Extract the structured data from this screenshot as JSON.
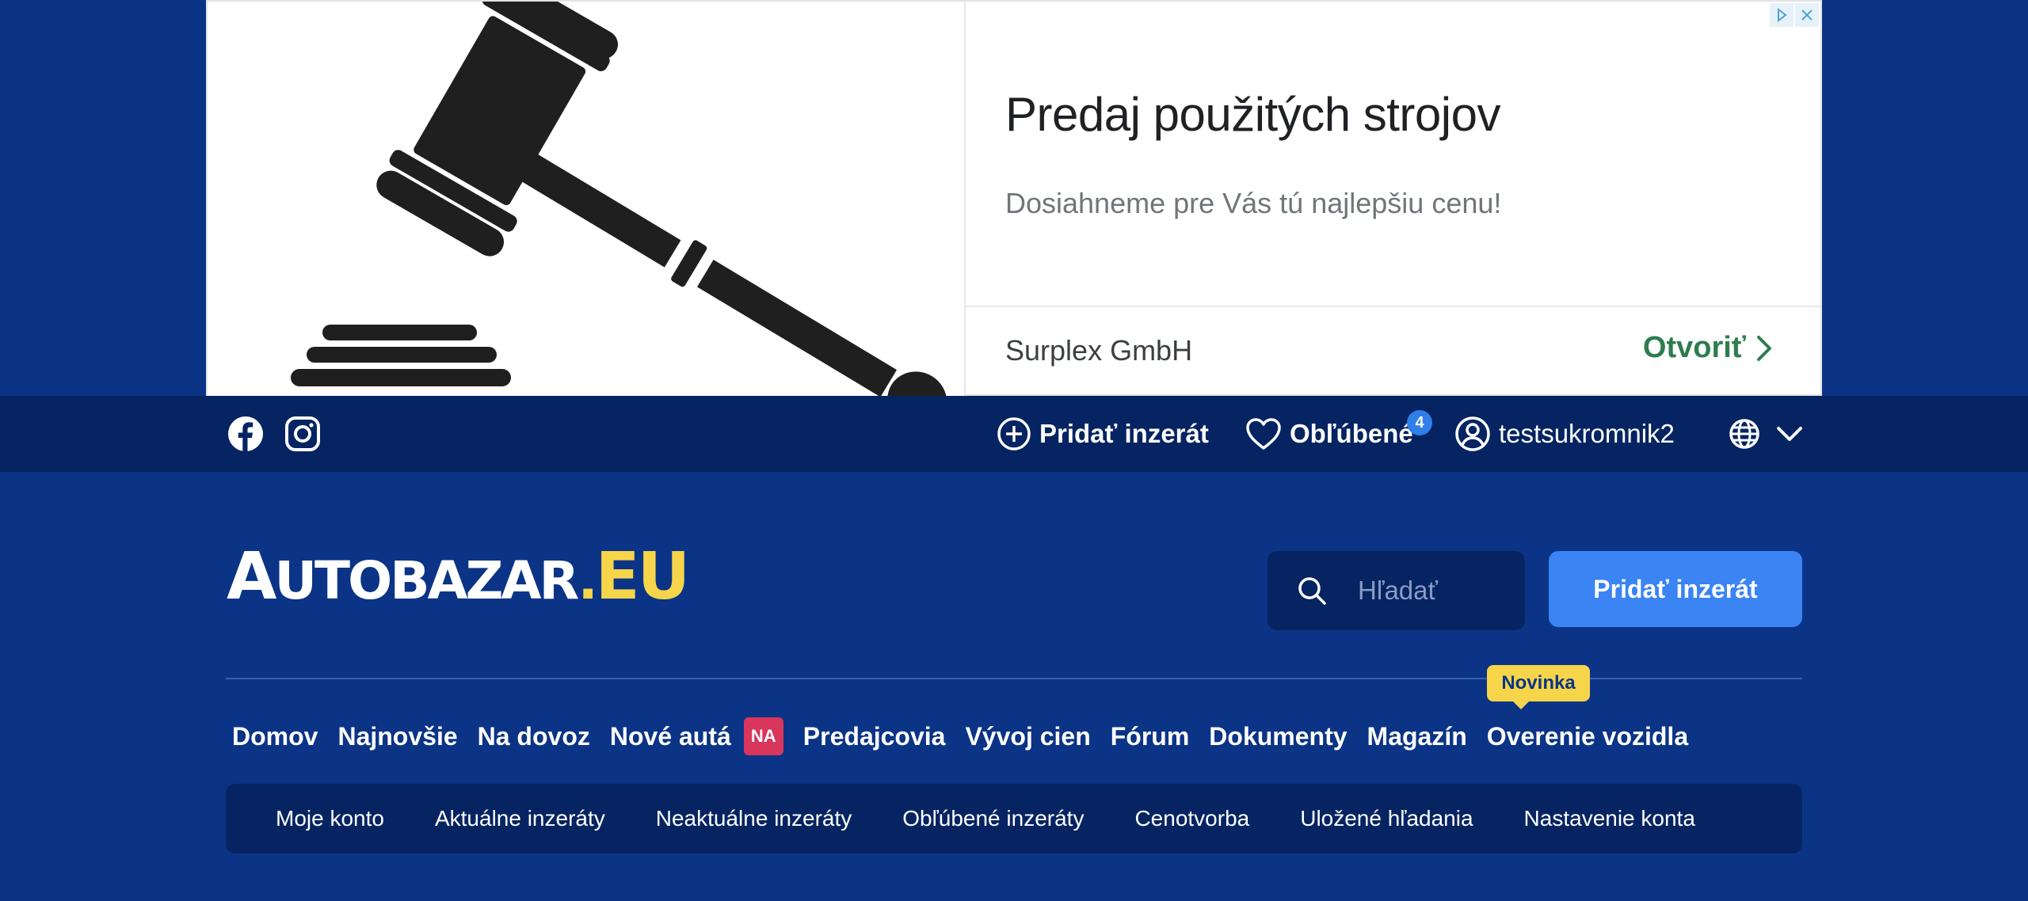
{
  "ad": {
    "headline": "Predaj použitých strojov",
    "description": "Dosiahneme pre Vás tú najlepšiu cenu!",
    "advertiser": "Surplex GmbH",
    "cta_label": "Otvoriť",
    "image_icon": "gavel-icon"
  },
  "topbar": {
    "social": [
      "facebook-icon",
      "instagram-icon"
    ],
    "add_listing_label": "Pridať inzerát",
    "favorites_label": "Obľúbené",
    "favorites_count": "4",
    "username": "testsukromnik2",
    "language_icon": "globe-icon"
  },
  "logo": {
    "a": "A",
    "main": "UTOBAZAR",
    "dot": ".",
    "eu": "EU"
  },
  "search": {
    "placeholder": "Hľadať"
  },
  "header": {
    "add_button_label": "Pridať inzerát"
  },
  "nav": {
    "items": [
      "Domov",
      "Najnovšie",
      "Na dovoz",
      "Nové autá",
      "Predajcovia",
      "Vývoj cien",
      "Fórum",
      "Dokumenty",
      "Magazín",
      "Overenie vozidla"
    ],
    "new_cars_badge": "NA",
    "novinka_label": "Novinka"
  },
  "subnav": {
    "items": [
      "Moje konto",
      "Aktuálne inzeráty",
      "Neaktuálne inzeráty",
      "Obľúbené inzeráty",
      "Cenotvorba",
      "Uložené hľadania",
      "Nastavenie konta"
    ]
  },
  "colors": {
    "background": "#0b3486",
    "topbar": "#062462",
    "accent_blue": "#3a84f3",
    "yellow": "#f6d54a",
    "badge_red": "#d8365c",
    "cta_green": "#2e7d4f"
  }
}
